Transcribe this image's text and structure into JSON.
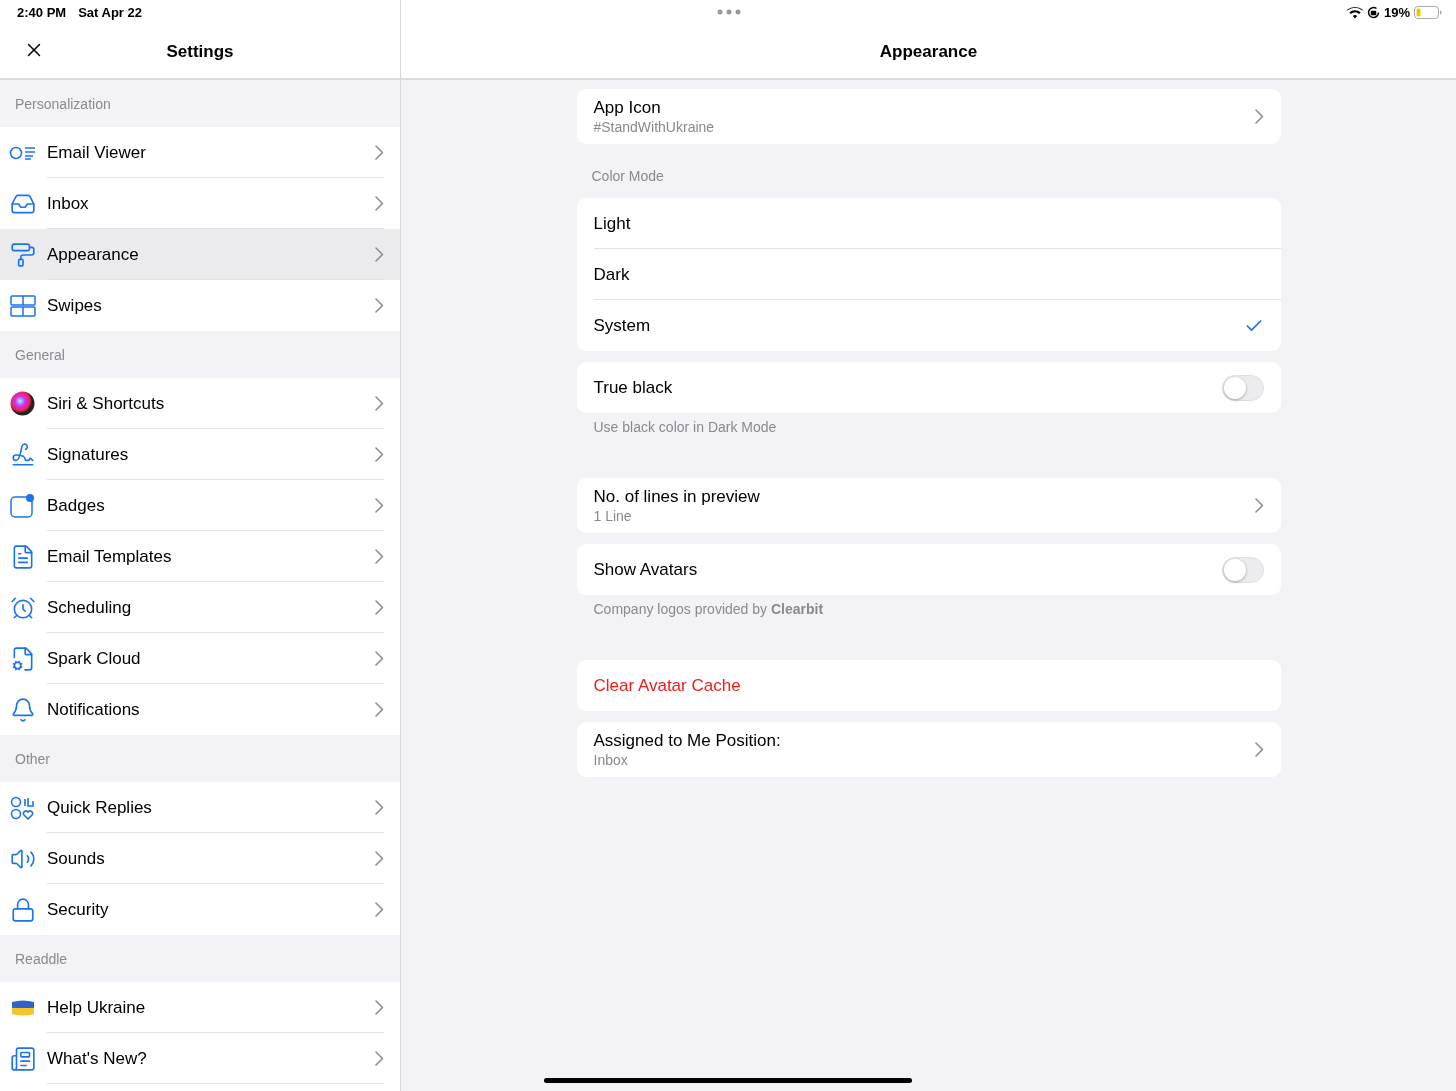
{
  "status_bar": {
    "time": "2:40 PM",
    "date": "Sat Apr 22",
    "battery": "19%"
  },
  "sidebar": {
    "title": "Settings",
    "sections": [
      {
        "header": "Personalization",
        "items": [
          {
            "label": "Email Viewer",
            "selected": false
          },
          {
            "label": "Inbox",
            "selected": false
          },
          {
            "label": "Appearance",
            "selected": true
          },
          {
            "label": "Swipes",
            "selected": false
          }
        ]
      },
      {
        "header": "General",
        "items": [
          {
            "label": "Siri & Shortcuts",
            "selected": false
          },
          {
            "label": "Signatures",
            "selected": false
          },
          {
            "label": "Badges",
            "selected": false
          },
          {
            "label": "Email Templates",
            "selected": false
          },
          {
            "label": "Scheduling",
            "selected": false
          },
          {
            "label": "Spark Cloud",
            "selected": false
          },
          {
            "label": "Notifications",
            "selected": false
          }
        ]
      },
      {
        "header": "Other",
        "items": [
          {
            "label": "Quick Replies",
            "selected": false
          },
          {
            "label": "Sounds",
            "selected": false
          },
          {
            "label": "Security",
            "selected": false
          }
        ]
      },
      {
        "header": "Readdle",
        "items": [
          {
            "label": "Help Ukraine",
            "selected": false
          },
          {
            "label": "What's New?",
            "selected": false
          }
        ]
      }
    ]
  },
  "detail": {
    "title": "Appearance",
    "groups": [
      {
        "rows": [
          {
            "kind": "nav",
            "label": "App Icon",
            "subtitle": "#StandWithUkraine"
          }
        ]
      },
      {
        "header": "Color Mode",
        "rows": [
          {
            "kind": "option",
            "label": "Light",
            "selected": false
          },
          {
            "kind": "option",
            "label": "Dark",
            "selected": false
          },
          {
            "kind": "option",
            "label": "System",
            "selected": true
          }
        ]
      },
      {
        "rows": [
          {
            "kind": "toggle",
            "label": "True black",
            "on": false
          }
        ],
        "footer": "Use black color in Dark Mode"
      },
      {
        "rows": [
          {
            "kind": "nav",
            "label": "No. of lines in preview",
            "subtitle": "1 Line"
          }
        ]
      },
      {
        "rows": [
          {
            "kind": "toggle",
            "label": "Show Avatars",
            "on": false
          }
        ],
        "footer": "Company logos provided by **Clearbit**"
      },
      {
        "rows": [
          {
            "kind": "action",
            "label": "Clear Avatar Cache"
          }
        ]
      },
      {
        "rows": [
          {
            "kind": "nav",
            "label": "Assigned to Me Position:",
            "subtitle": "Inbox"
          }
        ]
      }
    ]
  }
}
